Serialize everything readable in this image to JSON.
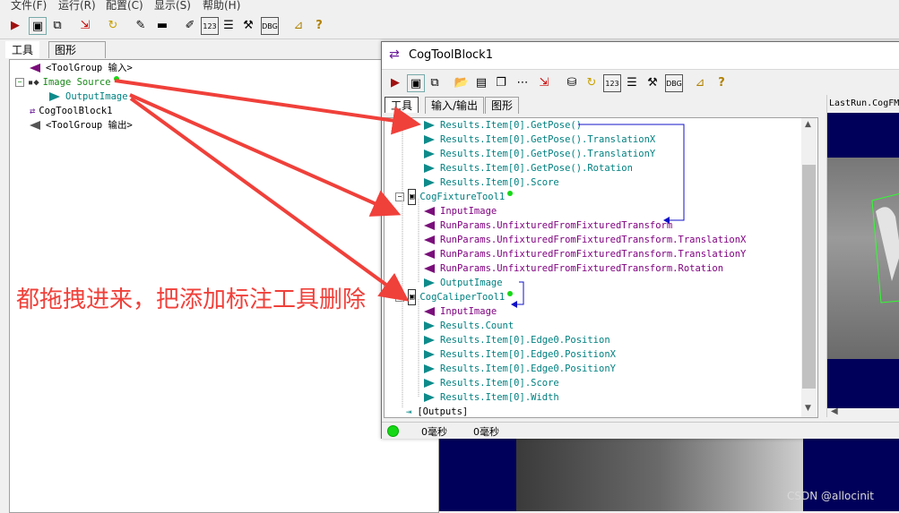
{
  "menu": [
    "文件(F)",
    "运行(R)",
    "配置(C)",
    "显示(S)",
    "帮助(H)"
  ],
  "left_tabs": [
    "工具",
    "图形"
  ],
  "left_tree": {
    "input": "<ToolGroup 输入>",
    "image_source": "Image Source",
    "output_image": "OutputImage",
    "tool_block": "CogToolBlock1",
    "output": "<ToolGroup 输出>"
  },
  "annotation": "都拖拽进来，把添加标注工具删除",
  "dialog": {
    "title": "CogToolBlock1",
    "tabs": [
      "工具",
      "输入/输出",
      "图形"
    ],
    "preview_title": "LastRun.CogFM",
    "tree": [
      {
        "text": "Results.Item[0].GetPose()",
        "kind": "out"
      },
      {
        "text": "Results.Item[0].GetPose().TranslationX",
        "kind": "out"
      },
      {
        "text": "Results.Item[0].GetPose().TranslationY",
        "kind": "out"
      },
      {
        "text": "Results.Item[0].GetPose().Rotation",
        "kind": "out"
      },
      {
        "text": "Results.Item[0].Score",
        "kind": "out"
      },
      {
        "text": "CogFixtureTool1",
        "kind": "tool"
      },
      {
        "text": "InputImage",
        "kind": "in"
      },
      {
        "text": "RunParams.UnfixturedFromFixturedTransform",
        "kind": "in"
      },
      {
        "text": "RunParams.UnfixturedFromFixturedTransform.TranslationX",
        "kind": "in"
      },
      {
        "text": "RunParams.UnfixturedFromFixturedTransform.TranslationY",
        "kind": "in"
      },
      {
        "text": "RunParams.UnfixturedFromFixturedTransform.Rotation",
        "kind": "in"
      },
      {
        "text": "OutputImage",
        "kind": "out"
      },
      {
        "text": "CogCaliperTool1",
        "kind": "tool"
      },
      {
        "text": "InputImage",
        "kind": "in"
      },
      {
        "text": "Results.Count",
        "kind": "out"
      },
      {
        "text": "Results.Item[0].Edge0.Position",
        "kind": "out"
      },
      {
        "text": "Results.Item[0].Edge0.PositionX",
        "kind": "out"
      },
      {
        "text": "Results.Item[0].Edge0.PositionY",
        "kind": "out"
      },
      {
        "text": "Results.Item[0].Score",
        "kind": "out"
      },
      {
        "text": "Results.Item[0].Width",
        "kind": "out"
      },
      {
        "text": "[Outputs]",
        "kind": "outputs"
      }
    ],
    "status": [
      "0毫秒",
      "0毫秒"
    ]
  },
  "watermark": "CSDN @allocinit",
  "colors": {
    "arrow": "#f0403a",
    "in": "#7a0d7a",
    "out": "#0e8b8b",
    "link": "#1010c8",
    "ok": "#16d816"
  }
}
